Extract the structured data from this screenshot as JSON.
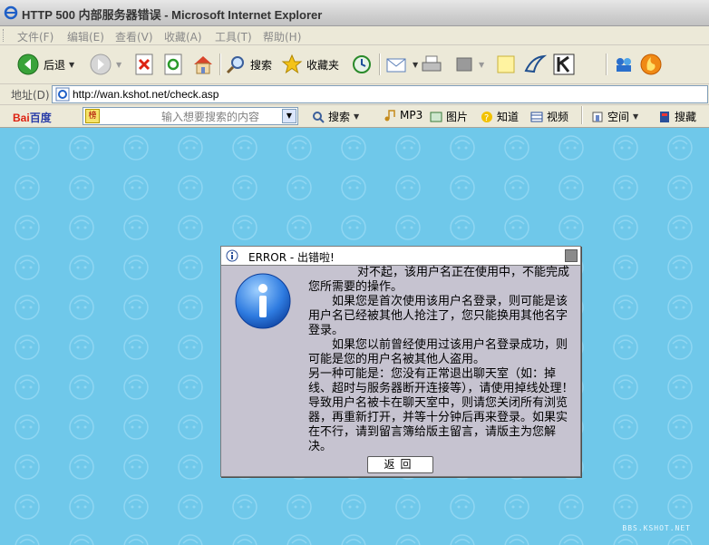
{
  "window": {
    "title": "HTTP 500 内部服务器错误 - Microsoft Internet Explorer"
  },
  "menu": [
    "文件(F)",
    "编辑(E)",
    "查看(V)",
    "收藏(A)",
    "工具(T)",
    "帮助(H)"
  ],
  "toolbar": {
    "back": "后退",
    "search": "搜索",
    "favorites": "收藏夹"
  },
  "address": {
    "label": "地址(D)",
    "url": "http://wan.kshot.net/check.asp"
  },
  "baidu": {
    "logo_red": "Bai",
    "logo_blue": "百度",
    "placeholder": "输入想要搜索的内容",
    "hot_tag": "榜",
    "items": [
      "搜索",
      "MP3",
      "图片",
      "知道",
      "视频",
      "空间",
      "搜藏"
    ]
  },
  "dialog": {
    "title": "ERROR - 出错啦!",
    "lines": [
      "对不起，该用户名正在使用中，不能完成您所需要的操作。",
      "如果您是首次使用该用户名登录，则可能是该用户名已经被其他人抢注了，您只能换用其他名字登录。",
      "如果您以前曾经使用过该用户名登录成功，则可能是您的用户名被其他人盗用。",
      "另一种可能是：您没有正常退出聊天室（如：掉线、超时与服务器断开连接等），请使用掉线处理！导致用户名被卡在聊天室中，则请您关闭所有浏览器，再重新打开，并等十分钟后再来登录。如果实在不行，请到留言簿给版主留言，请版主为您解决。"
    ],
    "button": "返回"
  },
  "watermark": "BBS.KSHOT.NET",
  "colors": {
    "content_bg": "#6fc8ea",
    "dialog_bg": "#c6c3d0"
  }
}
